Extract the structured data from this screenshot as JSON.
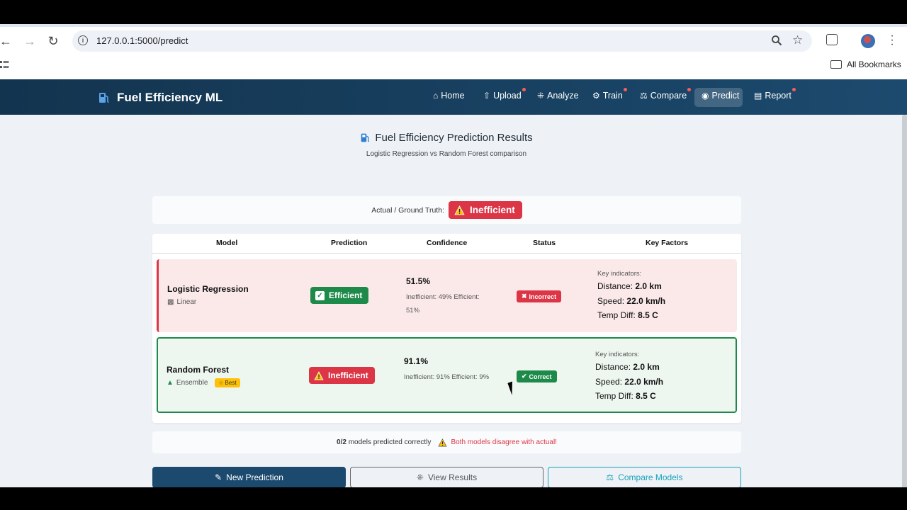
{
  "browser": {
    "url": "127.0.0.1:5000/predict",
    "bookmarks_label": "All Bookmarks"
  },
  "navbar": {
    "brand": "Fuel Efficiency ML",
    "items": [
      {
        "label": "Home",
        "icon": "home-icon",
        "dot": false
      },
      {
        "label": "Upload",
        "icon": "upload-icon",
        "dot": true
      },
      {
        "label": "Analyze",
        "icon": "chart-line-icon",
        "dot": false
      },
      {
        "label": "Train",
        "icon": "robot-icon",
        "dot": true
      },
      {
        "label": "Compare",
        "icon": "balance-scale-icon",
        "dot": true
      },
      {
        "label": "Predict",
        "icon": "gauge-icon",
        "dot": false,
        "active": true
      },
      {
        "label": "Report",
        "icon": "file-icon",
        "dot": true
      }
    ]
  },
  "header": {
    "title": "Fuel Efficiency Prediction Results",
    "subtitle": "Logistic Regression vs Random Forest comparison"
  },
  "ground_truth": {
    "label": "Actual / Ground Truth:",
    "value": "Inefficient"
  },
  "table": {
    "columns": [
      "Model",
      "Prediction",
      "Confidence",
      "Status",
      "Key Factors"
    ],
    "rows": [
      {
        "model": "Logistic Regression",
        "type": "Linear",
        "best": "",
        "prediction": "Efficient",
        "confidence": "51.5%",
        "confidence_detail": "Inefficient: 49% Efficient: 51%",
        "status": "Incorrect",
        "kf_head": "Key indicators:",
        "distance_label": "Distance:",
        "distance": "2.0 km",
        "speed_label": "Speed:",
        "speed": "22.0 km/h",
        "temp_label": "Temp Diff:",
        "temp": "8.5 C"
      },
      {
        "model": "Random Forest",
        "type": "Ensemble",
        "best": "Best",
        "prediction": "Inefficient",
        "confidence": "91.1%",
        "confidence_detail": "Inefficient: 91% Efficient: 9%",
        "status": "Correct",
        "kf_head": "Key indicators:",
        "distance_label": "Distance:",
        "distance": "2.0 km",
        "speed_label": "Speed:",
        "speed": "22.0 km/h",
        "temp_label": "Temp Diff:",
        "temp": "8.5 C"
      }
    ]
  },
  "summary": {
    "count": "0/2",
    "text": "models predicted correctly",
    "warning": "Both models disagree with actual!"
  },
  "buttons": {
    "new_prediction": "New Prediction",
    "view_results": "View Results",
    "compare_models": "Compare Models"
  },
  "colors": {
    "navbar": "#1c4a6e",
    "danger": "#dc3545",
    "success": "#1e8a4a",
    "warning": "#ffc107",
    "info": "#17a2b8"
  }
}
